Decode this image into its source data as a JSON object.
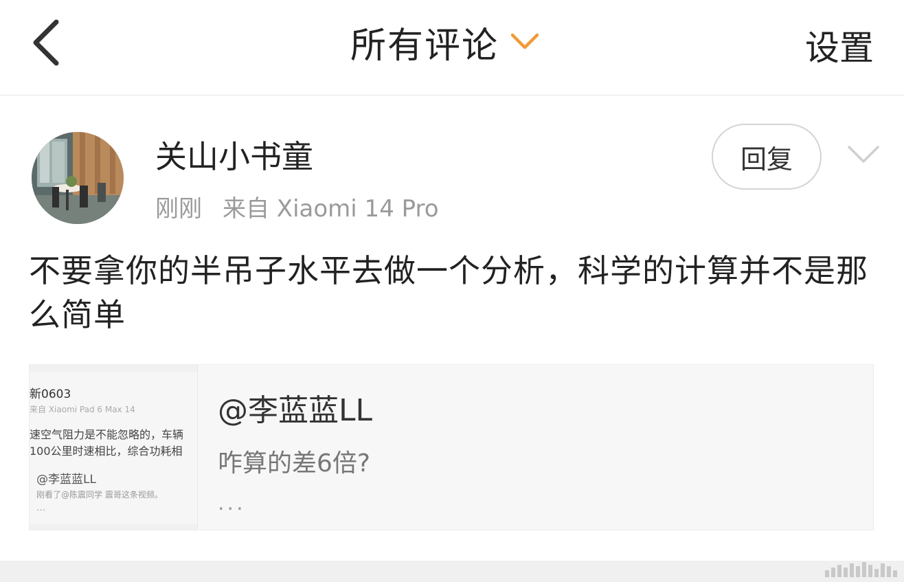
{
  "header": {
    "title": "所有评论",
    "settings_label": "设置",
    "accent_color": "#f09a37"
  },
  "comment": {
    "username": "关山小书童",
    "time": "刚刚",
    "source": "来自 Xiaomi 14 Pro",
    "reply_label": "回复",
    "text": "不要拿你的半吊子水平去做一个分析，科学的计算并不是那么简单"
  },
  "quote": {
    "user": "@李蓝蓝LL",
    "text": "咋算的差6倍?",
    "ellipsis": "...",
    "thumbnail": {
      "line1": "新0603",
      "line2": "来自 Xiaomi Pad 6 Max 14",
      "line3": "速空气阻力是不能忽略的，车辆",
      "line4": "100公里时速相比，综合功耗相",
      "line5": "@李蓝蓝LL",
      "line6": "刚看了@陈震同学 震哥这条视频。",
      "line7": "..."
    }
  },
  "icons": {
    "back": "back-arrow-icon",
    "dropdown": "chevron-down-icon",
    "more": "chevron-down-icon"
  }
}
